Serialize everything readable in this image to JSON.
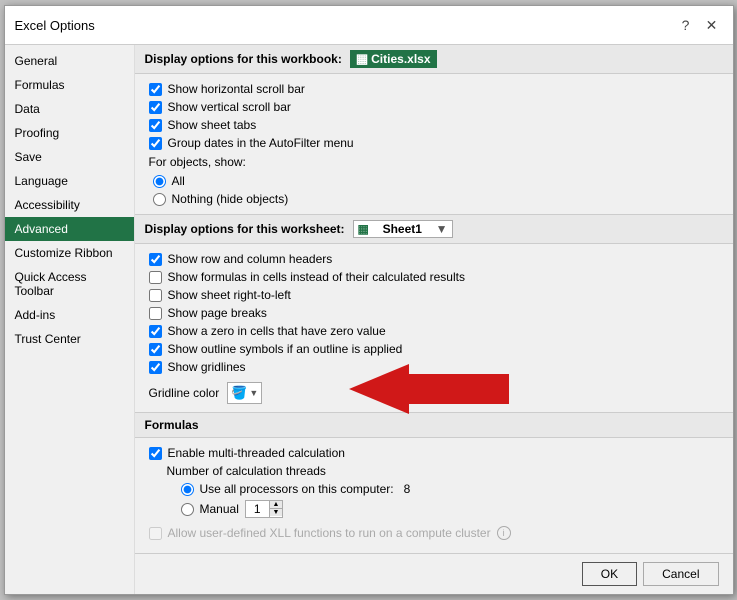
{
  "dialog": {
    "title": "Excel Options",
    "help_btn": "?",
    "close_btn": "✕"
  },
  "sidebar": {
    "items": [
      {
        "label": "General",
        "active": false
      },
      {
        "label": "Formulas",
        "active": false
      },
      {
        "label": "Data",
        "active": false
      },
      {
        "label": "Proofing",
        "active": false
      },
      {
        "label": "Save",
        "active": false
      },
      {
        "label": "Language",
        "active": false
      },
      {
        "label": "Accessibility",
        "active": false
      },
      {
        "label": "Advanced",
        "active": true
      },
      {
        "label": "Customize Ribbon",
        "active": false
      },
      {
        "label": "Quick Access Toolbar",
        "active": false
      },
      {
        "label": "Add-ins",
        "active": false
      },
      {
        "label": "Trust Center",
        "active": false
      }
    ]
  },
  "workbook_section": {
    "header": "Display options for this workbook:",
    "workbook_name": "Cities.xlsx",
    "checkboxes": [
      {
        "id": "cb1",
        "label": "Show horizontal scroll bar",
        "checked": true
      },
      {
        "id": "cb2",
        "label": "Show vertical scroll bar",
        "checked": true
      },
      {
        "id": "cb3",
        "label": "Show sheet tabs",
        "checked": true
      },
      {
        "id": "cb4",
        "label": "Group dates in the AutoFilter menu",
        "checked": true
      }
    ],
    "for_objects_label": "For objects, show:",
    "radio_all": "All",
    "radio_nothing": "Nothing (hide objects)"
  },
  "worksheet_section": {
    "header": "Display options for this worksheet:",
    "sheet_name": "Sheet1",
    "checkboxes": [
      {
        "id": "ws1",
        "label": "Show row and column headers",
        "checked": true
      },
      {
        "id": "ws2",
        "label": "Show formulas in cells instead of their calculated results",
        "checked": false
      },
      {
        "id": "ws3",
        "label": "Show sheet right-to-left",
        "checked": false
      },
      {
        "id": "ws4",
        "label": "Show page breaks",
        "checked": false
      },
      {
        "id": "ws5",
        "label": "Show a zero in cells that have zero value",
        "checked": true
      },
      {
        "id": "ws6",
        "label": "Show outline symbols if an outline is applied",
        "checked": true
      },
      {
        "id": "ws7",
        "label": "Show gridlines",
        "checked": true
      }
    ],
    "gridline_color_label": "Gridline color",
    "color_swatch": "#ffffff"
  },
  "formulas_section": {
    "header": "Formulas",
    "enable_label": "Enable multi-threaded calculation",
    "enable_checked": true,
    "threads_label": "Number of calculation threads",
    "use_all_label": "Use all processors on this computer:",
    "use_all_count": "8",
    "manual_label": "Manual",
    "manual_value": "1",
    "allow_label": "Allow user-defined XLL functions to run on a compute cluster"
  },
  "footer": {
    "ok_label": "OK",
    "cancel_label": "Cancel"
  }
}
